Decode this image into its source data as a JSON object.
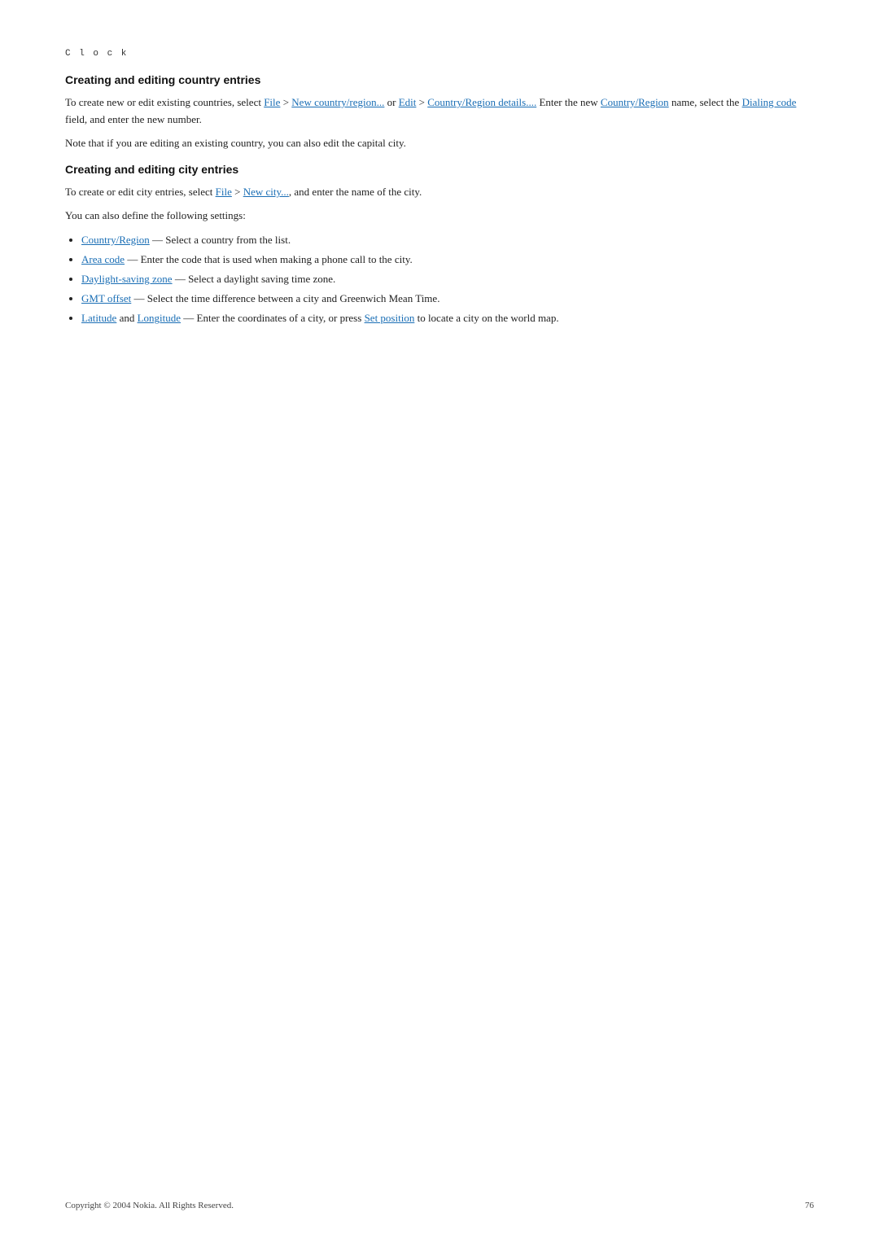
{
  "page": {
    "label": "C l o c k",
    "footer": {
      "copyright": "Copyright © 2004 Nokia. All Rights Reserved.",
      "page_number": "76"
    }
  },
  "section1": {
    "heading": "Creating and editing country entries",
    "para1_prefix": "To create new or edit existing countries, select ",
    "file_link": "File",
    "arrow1": " > ",
    "new_country_link": "New country/region...",
    "or_text": " or ",
    "edit_link": "Edit",
    "arrow2": " > ",
    "country_region_details_link": "Country/Region details....",
    "para1_suffix": " Enter the new ",
    "country_region_link2": "Country/Region",
    "para1_suffix2": " name, select the ",
    "dialing_code_link": "Dialing code",
    "para1_suffix3": " field, and enter the new number.",
    "para2": "Note that if you are editing an existing country, you can also edit the capital city."
  },
  "section2": {
    "heading": "Creating and editing city entries",
    "para1_prefix": "To create or edit city entries, select ",
    "file_link": "File",
    "arrow1": " > ",
    "new_city_link": "New city...",
    "para1_suffix": ", and enter the name of the city.",
    "para2": "You can also define the following settings:",
    "bullets": [
      {
        "link_text": "Country/Region",
        "desc": " — Select a country from the list."
      },
      {
        "link_text": "Area code",
        "desc": " — Enter the code that is used when making a phone call to the city."
      },
      {
        "link_text": "Daylight-saving zone",
        "desc": "  — Select a daylight saving time zone."
      },
      {
        "link_text": "GMT offset",
        "desc": " — Select the time difference between a city and Greenwich Mean Time."
      },
      {
        "link_text1": "Latitude",
        "and_text": " and ",
        "link_text2": "Longitude",
        "desc_prefix": " — Enter the coordinates of a city, or press ",
        "set_position_link": "Set position",
        "desc_suffix": " to locate a city on the world map."
      }
    ]
  }
}
